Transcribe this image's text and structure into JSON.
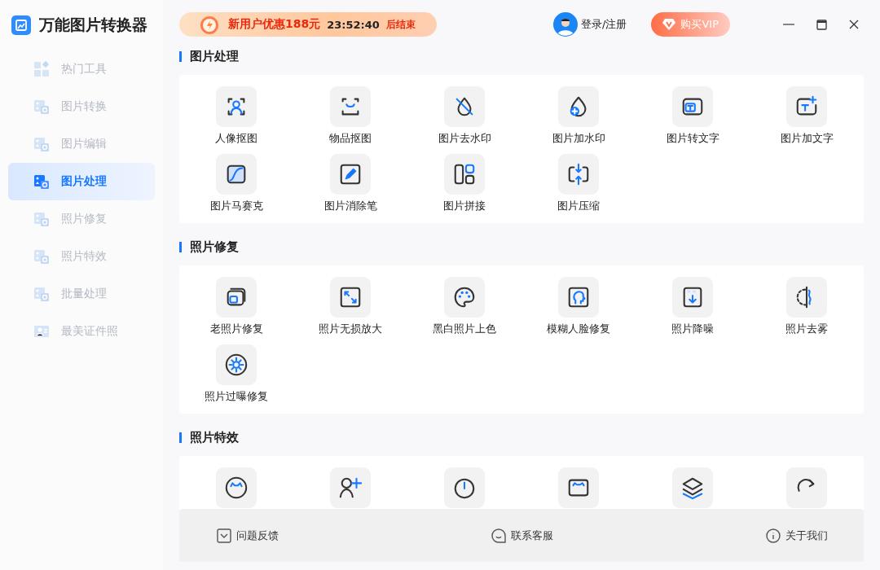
{
  "app": {
    "title": "万能图片转换器"
  },
  "sidebar": {
    "items": [
      {
        "label": "热门工具",
        "kind": "hot",
        "selected": false
      },
      {
        "label": "图片转换",
        "kind": "convert",
        "selected": false
      },
      {
        "label": "图片编辑",
        "kind": "edit",
        "selected": false
      },
      {
        "label": "图片处理",
        "kind": "process",
        "selected": true
      },
      {
        "label": "照片修复",
        "kind": "repair",
        "selected": false
      },
      {
        "label": "照片特效",
        "kind": "effect",
        "selected": false
      },
      {
        "label": "批量处理",
        "kind": "batch",
        "selected": false
      },
      {
        "label": "最美证件照",
        "kind": "idphoto",
        "selected": false
      }
    ]
  },
  "promo": {
    "text": "新用户优惠188元",
    "countdown": "23:52:40",
    "suffix": "后结束"
  },
  "account": {
    "login": "登录/注册",
    "vip": "购买VIP"
  },
  "sections": [
    {
      "title": "图片处理",
      "tools": [
        {
          "label": "人像抠图",
          "kind": "portrait"
        },
        {
          "label": "物品抠图",
          "kind": "bag"
        },
        {
          "label": "图片去水印",
          "kind": "nowater"
        },
        {
          "label": "图片加水印",
          "kind": "addwater"
        },
        {
          "label": "图片转文字",
          "kind": "totext"
        },
        {
          "label": "图片加文字",
          "kind": "addtext"
        },
        {
          "label": "图片马赛克",
          "kind": "mosaic"
        },
        {
          "label": "图片消除笔",
          "kind": "pen"
        },
        {
          "label": "图片拼接",
          "kind": "collage"
        },
        {
          "label": "图片压缩",
          "kind": "compress"
        }
      ]
    },
    {
      "title": "照片修复",
      "tools": [
        {
          "label": "老照片修复",
          "kind": "oldphoto"
        },
        {
          "label": "照片无损放大",
          "kind": "enlarge"
        },
        {
          "label": "黑白照片上色",
          "kind": "palette"
        },
        {
          "label": "模糊人脸修复",
          "kind": "face"
        },
        {
          "label": "照片降噪",
          "kind": "denoise"
        },
        {
          "label": "照片去雾",
          "kind": "dehaze"
        },
        {
          "label": "照片过曝修复",
          "kind": "sun"
        }
      ]
    },
    {
      "title": "照片特效",
      "tools": [
        {
          "kind": "cat"
        },
        {
          "kind": "person"
        },
        {
          "kind": "timer"
        },
        {
          "kind": "frame"
        },
        {
          "kind": "layers"
        },
        {
          "kind": "spin"
        }
      ]
    }
  ],
  "footer": [
    {
      "label": "问题反馈",
      "kind": "feedback"
    },
    {
      "label": "联系客服",
      "kind": "service"
    },
    {
      "label": "关于我们",
      "kind": "about"
    }
  ]
}
